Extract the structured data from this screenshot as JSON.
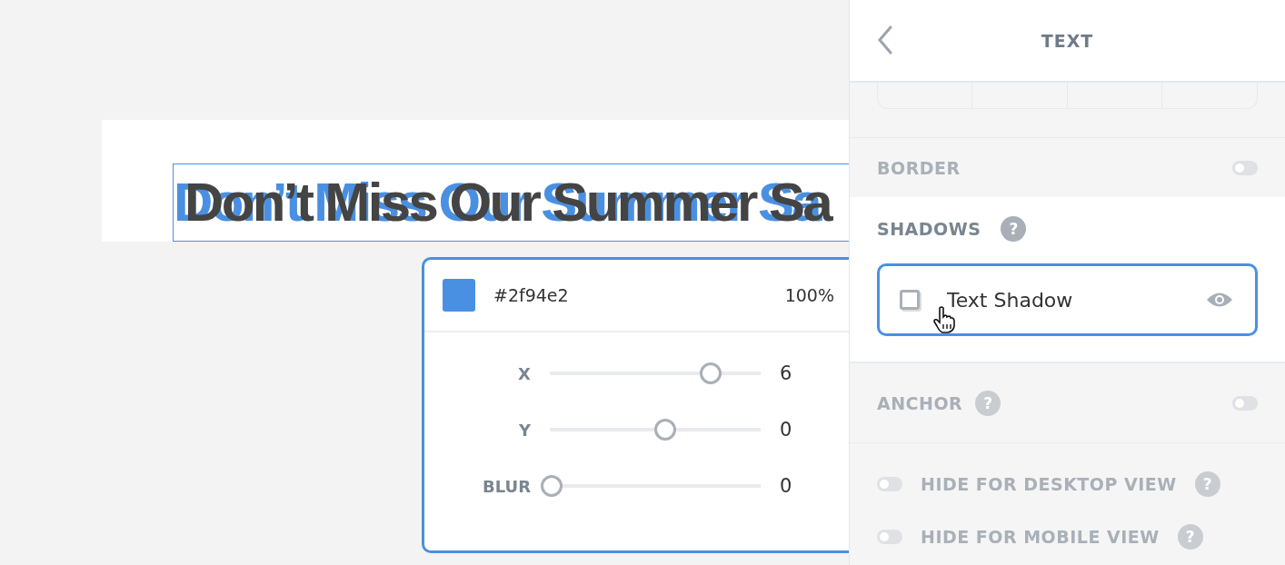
{
  "canvas": {
    "headline": "Don’t Miss Our Summer Sa"
  },
  "shadow_popover": {
    "color": "#4a90e2",
    "hex": "#2f94e2",
    "opacity": "100%",
    "sliders": [
      {
        "label": "X",
        "level": 0.7,
        "value": "6"
      },
      {
        "label": "Y",
        "level": 0.5,
        "value": "0"
      },
      {
        "label": "BLUR",
        "level": 0,
        "value": "0"
      }
    ]
  },
  "panel": {
    "title": "TEXT",
    "border": {
      "label": "BORDER",
      "disabled": true,
      "on": false
    },
    "shadows": {
      "label": "SHADOWS",
      "help": "?",
      "items": [
        {
          "label": "Text Shadow",
          "checked": false,
          "visible": true,
          "selected": true
        }
      ]
    },
    "anchor": {
      "label": "ANCHOR",
      "help": "?",
      "disabled": true,
      "on": false
    },
    "visibility": [
      {
        "label": "HIDE FOR DESKTOP VIEW",
        "help": "?",
        "on": false,
        "disabled": true
      },
      {
        "label": "HIDE FOR MOBILE VIEW",
        "help": "?",
        "on": false,
        "disabled": true
      }
    ]
  }
}
